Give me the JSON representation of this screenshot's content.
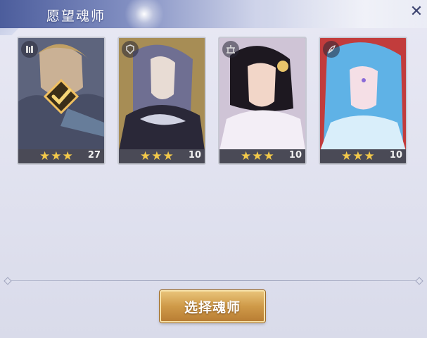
{
  "window": {
    "title": "愿望魂师"
  },
  "cards": [
    {
      "level": "27",
      "stars": "★★★",
      "class_icon": "tower-icon",
      "selected": true,
      "palette": [
        "#2d3a56",
        "#d4a650",
        "#f4d58a"
      ]
    },
    {
      "level": "10",
      "stars": "★★★",
      "class_icon": "shield-icon",
      "selected": false,
      "palette": [
        "#3b3550",
        "#8a87a8",
        "#d0cce0"
      ]
    },
    {
      "level": "10",
      "stars": "★★★",
      "class_icon": "shrine-icon",
      "selected": false,
      "palette": [
        "#2a2430",
        "#f0e8f0",
        "#c48ad0"
      ]
    },
    {
      "level": "10",
      "stars": "★★★",
      "class_icon": "feather-icon",
      "selected": false,
      "palette": [
        "#b83a3a",
        "#6cb8e8",
        "#d8eefa"
      ]
    }
  ],
  "actions": {
    "select_label": "选择魂师"
  },
  "colors": {
    "accent_gold": "#cf9a48",
    "star": "#f3c94a",
    "title_bar": "#4c5d9c"
  }
}
